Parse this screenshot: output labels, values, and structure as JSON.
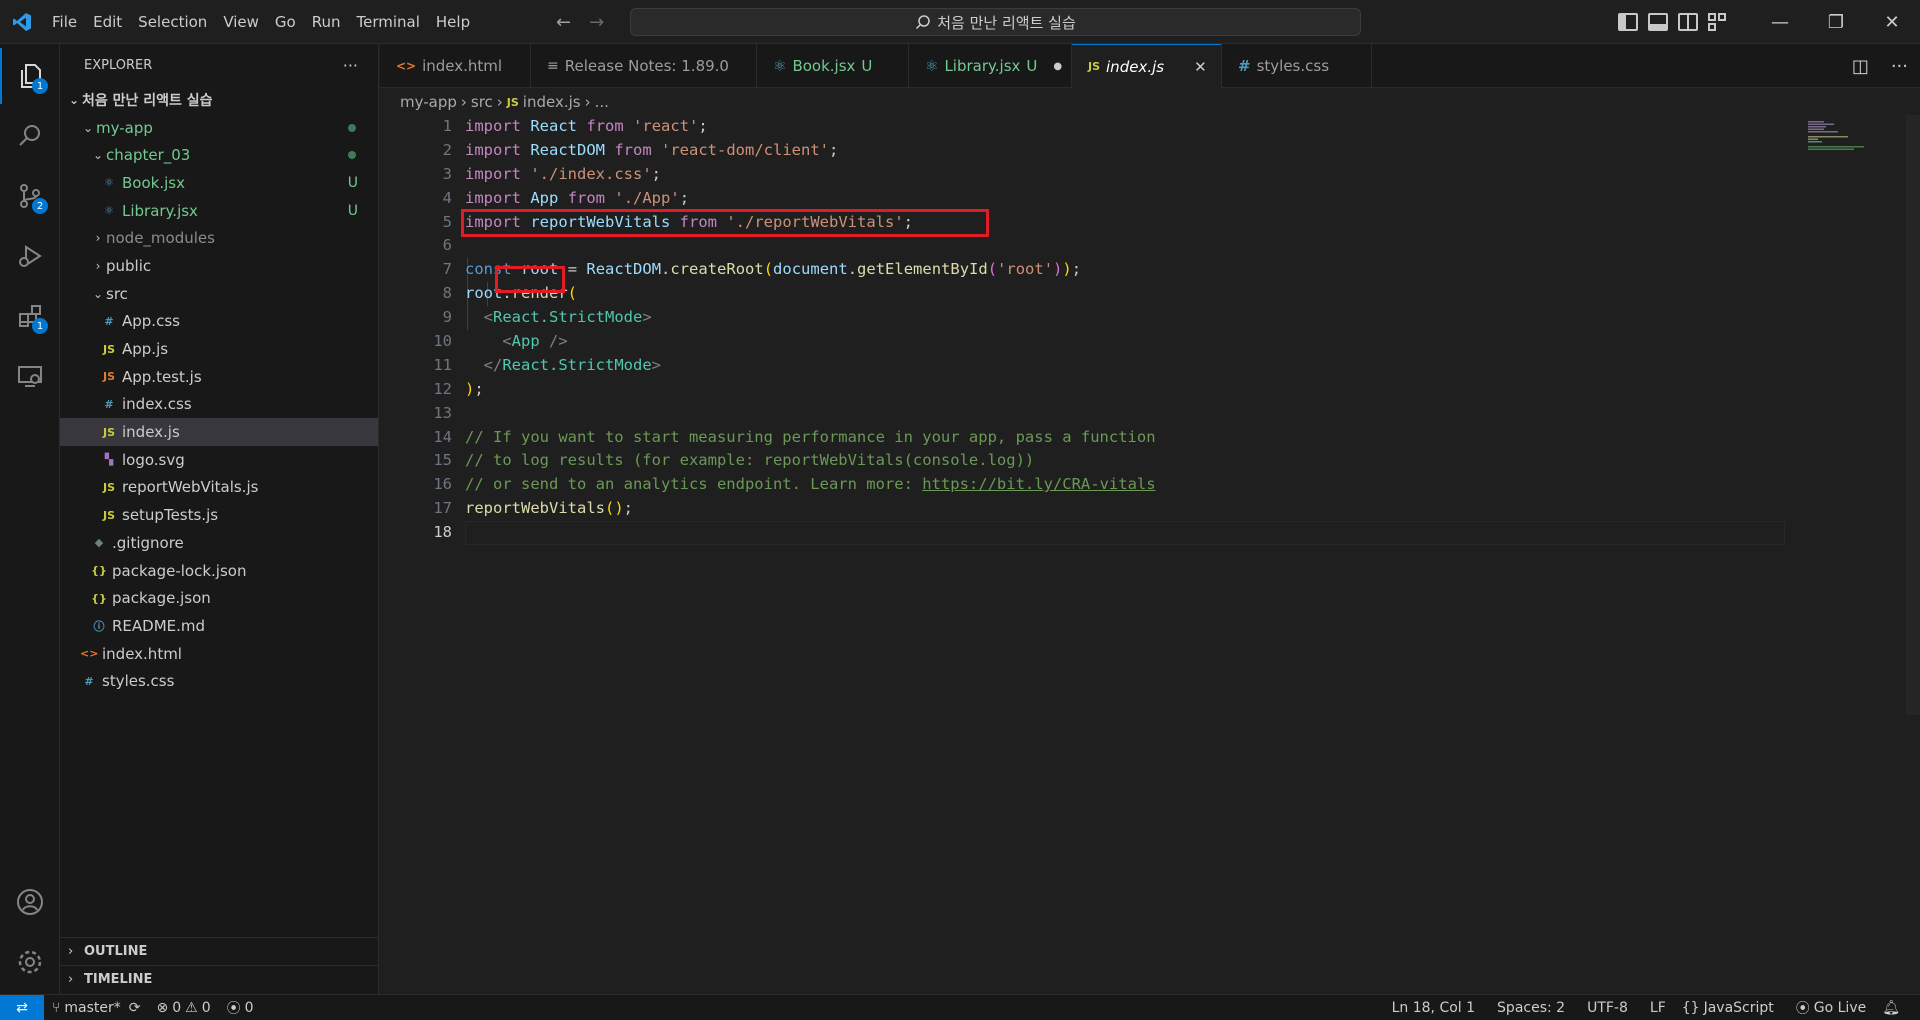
{
  "menu": [
    "File",
    "Edit",
    "Selection",
    "View",
    "Go",
    "Run",
    "Terminal",
    "Help"
  ],
  "command_center": "처음 만난 리액트 실습",
  "activity": {
    "explorer_badge": "1",
    "scm_badge": "2",
    "extensions_badge": "1"
  },
  "sidebar": {
    "title": "EXPLORER",
    "root": "처음 만난 리액트 실습",
    "items": [
      {
        "label": "my-app"
      },
      {
        "label": "chapter_03"
      },
      {
        "label": "Book.jsx",
        "status": "U"
      },
      {
        "label": "Library.jsx",
        "status": "U"
      },
      {
        "label": "node_modules"
      },
      {
        "label": "public"
      },
      {
        "label": "src"
      },
      {
        "label": "App.css"
      },
      {
        "label": "App.js"
      },
      {
        "label": "App.test.js"
      },
      {
        "label": "index.css"
      },
      {
        "label": "index.js"
      },
      {
        "label": "logo.svg"
      },
      {
        "label": "reportWebVitals.js"
      },
      {
        "label": "setupTests.js"
      },
      {
        "label": ".gitignore"
      },
      {
        "label": "package-lock.json"
      },
      {
        "label": "package.json"
      },
      {
        "label": "README.md"
      },
      {
        "label": "index.html"
      },
      {
        "label": "styles.css"
      }
    ],
    "outline": "OUTLINE",
    "timeline": "TIMELINE"
  },
  "tabs": [
    {
      "label": "index.html"
    },
    {
      "label": "Release Notes: 1.89.0"
    },
    {
      "label": "Book.jsx",
      "status": "U"
    },
    {
      "label": "Library.jsx",
      "status": "U"
    },
    {
      "label": "index.js"
    },
    {
      "label": "styles.css"
    }
  ],
  "breadcrumb": [
    "my-app",
    "src",
    "index.js",
    "..."
  ],
  "editor": {
    "line_numbers": [
      "1",
      "2",
      "3",
      "4",
      "5",
      "6",
      "7",
      "8",
      "9",
      "10",
      "11",
      "12",
      "13",
      "14",
      "15",
      "16",
      "17",
      "18"
    ],
    "lines": {
      "l1": [
        "import",
        "React",
        "from",
        "'react'",
        ";"
      ],
      "l2": [
        "import",
        "ReactDOM",
        "from",
        "'react-dom/client'",
        ";"
      ],
      "l3": [
        "import",
        "'./index.css'",
        ";"
      ],
      "l4": [
        "import",
        "App",
        "from",
        "'./App'",
        ";"
      ],
      "l5": [
        "import",
        "reportWebVitals",
        "from",
        "'./reportWebVitals'",
        ";"
      ],
      "l7": [
        "const",
        "root",
        "=",
        "ReactDOM",
        ".",
        "createRoot",
        "(",
        "document",
        ".",
        "getElementById",
        "(",
        "'root'",
        ")",
        ")",
        ";"
      ],
      "l8": [
        "root",
        ".",
        "render",
        "("
      ],
      "l9": [
        "<",
        "React.StrictMode",
        ">"
      ],
      "l10": [
        "<",
        "App",
        "/>"
      ],
      "l11": [
        "</",
        "React.StrictMode",
        ">"
      ],
      "l12": [
        ")",
        ";"
      ],
      "l14": "// If you want to start measuring performance in your app, pass a function",
      "l15": "// to log results (for example: reportWebVitals(console.log))",
      "l16": [
        "// or send to an analytics endpoint. Learn more: ",
        "https://bit.ly/CRA-vitals"
      ],
      "l17": [
        "reportWebVitals",
        "(",
        ")",
        ";"
      ]
    }
  },
  "status": {
    "branch": "master*",
    "errors": "0",
    "warnings": "0",
    "ports": "0",
    "position": "Ln 18, Col 1",
    "spaces": "Spaces: 2",
    "encoding": "UTF-8",
    "eol": "LF",
    "language": "JavaScript",
    "golive": "Go Live"
  },
  "colors": {
    "accent": "#0078d4",
    "highlight": "#e21b25"
  }
}
